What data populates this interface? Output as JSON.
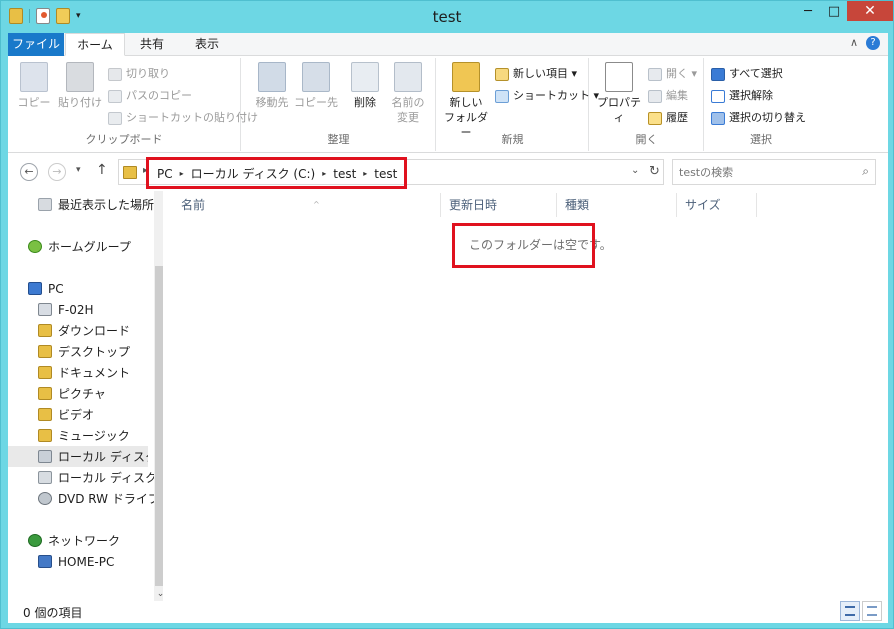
{
  "window": {
    "title": "test",
    "minimize_glyph": "─",
    "maximize_glyph": "□",
    "close_glyph": "✕"
  },
  "quick_access": {
    "icons": [
      "folder-icon",
      "properties-icon",
      "new-folder-icon"
    ],
    "dropdown_glyph": "▾"
  },
  "tabs": [
    {
      "label": "ファイル"
    },
    {
      "label": "ホーム"
    },
    {
      "label": "共有"
    },
    {
      "label": "表示"
    }
  ],
  "help": {
    "collapse_glyph": "∧",
    "help_glyph": "?"
  },
  "ribbon": {
    "clipboard": {
      "copy": "コピー",
      "paste": "貼り付け",
      "cut": "切り取り",
      "copy_path": "パスのコピー",
      "paste_shortcut": "ショートカットの貼り付け",
      "label": "クリップボード"
    },
    "organize": {
      "move_to": "移動先",
      "copy_to": "コピー先",
      "delete": "削除",
      "rename_line1": "名前の",
      "rename_line2": "変更",
      "label": "整理"
    },
    "new": {
      "new_folder_line1": "新しい",
      "new_folder_line2": "フォルダー",
      "new_item": "新しい項目 ▾",
      "easy_access": "ショートカット ▾",
      "label": "新規"
    },
    "open": {
      "properties": "プロパティ",
      "open": "開く ▾",
      "edit": "編集",
      "history": "履歴",
      "label": "開く"
    },
    "select": {
      "select_all": "すべて選択",
      "select_none": "選択解除",
      "invert": "選択の切り替え",
      "label": "選択"
    }
  },
  "navigation": {
    "back_glyph": "←",
    "forward_glyph": "→",
    "recent_glyph": "▾",
    "up_glyph": "↑",
    "breadcrumb": [
      "PC",
      "ローカル ディスク (C:)",
      "test",
      "test"
    ],
    "separator_glyph": "▸",
    "dropdown_glyph": "⌄",
    "refresh_glyph": "↻",
    "search_placeholder": "testの検索",
    "search_glyph": "⌕"
  },
  "nav_pane": {
    "items": [
      {
        "label": "最近表示した場所",
        "icon": "recent-places-icon"
      },
      {
        "label": "ホームグループ",
        "icon": "homegroup-icon"
      },
      {
        "label": "PC",
        "icon": "pc-icon"
      },
      {
        "label": "F-02H",
        "icon": "phone-icon"
      },
      {
        "label": "ダウンロード",
        "icon": "folder-icon"
      },
      {
        "label": "デスクトップ",
        "icon": "folder-icon"
      },
      {
        "label": "ドキュメント",
        "icon": "folder-icon"
      },
      {
        "label": "ピクチャ",
        "icon": "folder-icon"
      },
      {
        "label": "ビデオ",
        "icon": "folder-icon"
      },
      {
        "label": "ミュージック",
        "icon": "folder-icon"
      },
      {
        "label": "ローカル ディスク (",
        "icon": "drive-icon"
      },
      {
        "label": "ローカル ディスク (",
        "icon": "drive-icon"
      },
      {
        "label": "DVD RW ドライブ",
        "icon": "dvd-drive-icon"
      },
      {
        "label": "ネットワーク",
        "icon": "network-icon"
      },
      {
        "label": "HOME-PC",
        "icon": "computer-icon"
      }
    ],
    "scroll_down_glyph": "⌄"
  },
  "content": {
    "columns": [
      "名前",
      "更新日時",
      "種類",
      "サイズ"
    ],
    "sort_glyph": "^",
    "empty_message": "このフォルダーは空です。"
  },
  "status": {
    "item_count": "0 個の項目"
  },
  "colors": {
    "title_bar": "#6dd7e4",
    "file_tab": "#1979ca",
    "close_button": "#c7463a",
    "highlight_box": "#e0111e"
  }
}
